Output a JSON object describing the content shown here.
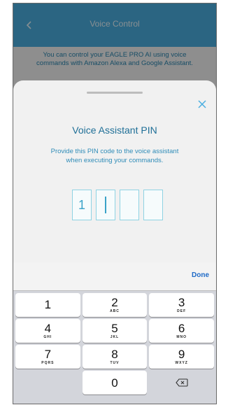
{
  "nav": {
    "title": "Voice Control",
    "back_icon": "chevron-left-icon"
  },
  "intro": {
    "text": "You can control your EAGLE PRO AI using voice commands with Amazon Alexa and Google Assistant."
  },
  "sheet": {
    "close_icon": "close-icon",
    "title": "Voice Assistant PIN",
    "description": "Provide this PIN code to the voice assistant when executing your commands.",
    "pin": [
      "1",
      "",
      "",
      ""
    ]
  },
  "keyboard": {
    "done_label": "Done",
    "keys": [
      {
        "digit": "1",
        "letters": ""
      },
      {
        "digit": "2",
        "letters": "ABC"
      },
      {
        "digit": "3",
        "letters": "DEF"
      },
      {
        "digit": "4",
        "letters": "GHI"
      },
      {
        "digit": "5",
        "letters": "JKL"
      },
      {
        "digit": "6",
        "letters": "MNO"
      },
      {
        "digit": "7",
        "letters": "PQRS"
      },
      {
        "digit": "8",
        "letters": "TUV"
      },
      {
        "digit": "9",
        "letters": "WXYZ"
      },
      {
        "digit": "0",
        "letters": ""
      }
    ],
    "delete_icon": "backspace-icon"
  },
  "colors": {
    "nav_blue": "#4aaee0",
    "title_blue": "#1f6f97",
    "pin_border": "#8fd3e3",
    "done_blue": "#1e6ac7"
  }
}
